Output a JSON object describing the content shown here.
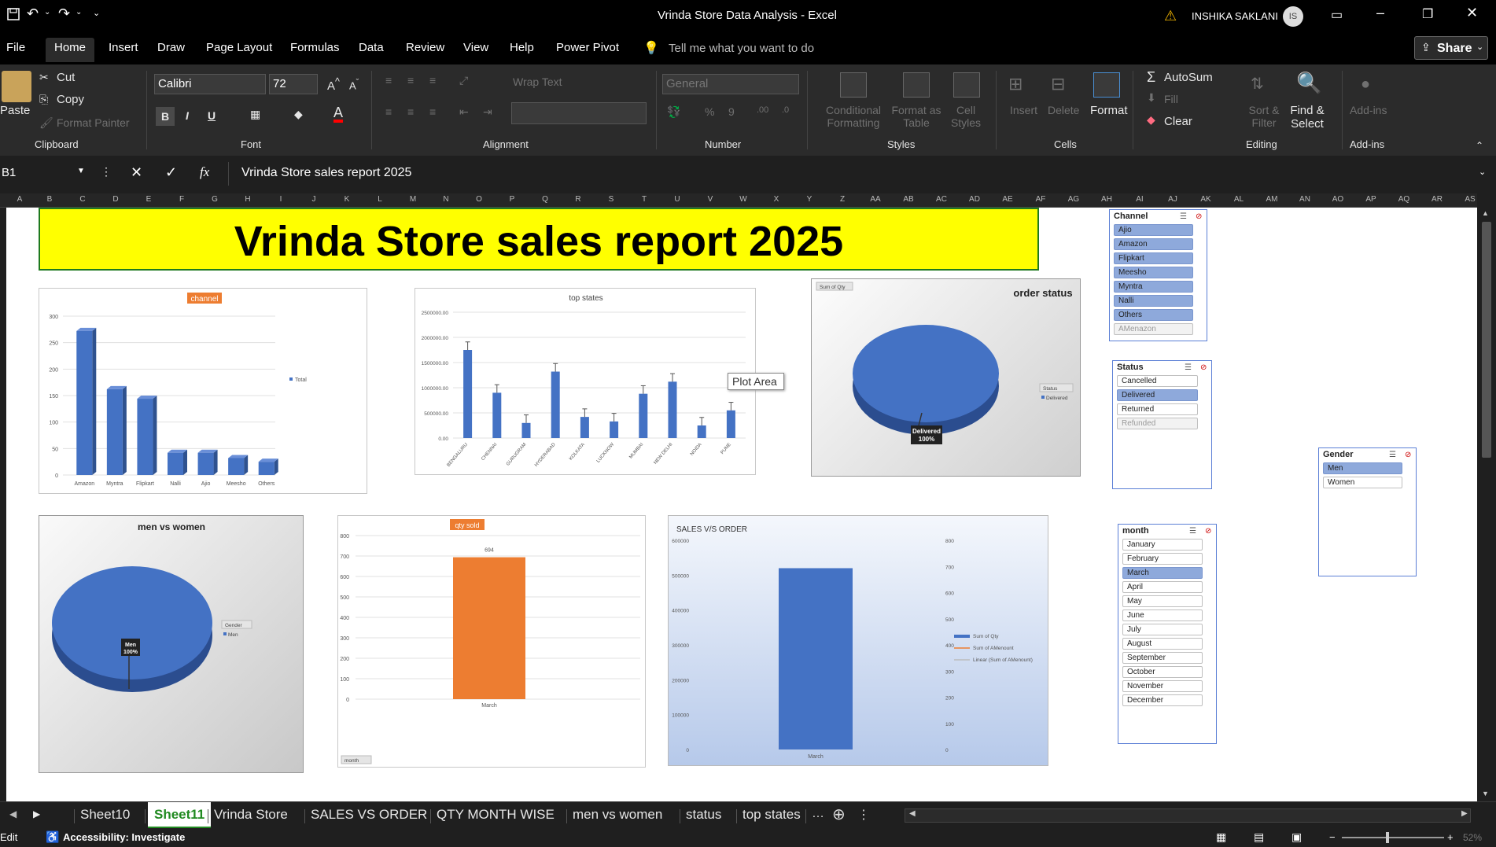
{
  "window": {
    "title": "Vrinda Store Data Analysis  -  Excel",
    "user": "INSHIKA SAKLANI",
    "user_initials": "IS"
  },
  "menu": [
    "File",
    "Home",
    "Insert",
    "Draw",
    "Page Layout",
    "Formulas",
    "Data",
    "Review",
    "View",
    "Help",
    "Power Pivot"
  ],
  "tell_me": "Tell me what you want to do",
  "share": "Share",
  "ribbon": {
    "clipboard": {
      "paste": "Paste",
      "cut": "Cut",
      "copy": "Copy",
      "format_painter": "Format Painter",
      "label": "Clipboard"
    },
    "font": {
      "name": "Calibri",
      "size": "72",
      "label": "Font"
    },
    "alignment": {
      "wrap_text": "Wrap Text",
      "label": "Alignment"
    },
    "number": {
      "format": "General",
      "label": "Number"
    },
    "styles": {
      "conditional": "Conditional Formatting",
      "format_table": "Format as Table",
      "cell_styles": "Cell Styles",
      "label": "Styles"
    },
    "cells": {
      "insert": "Insert",
      "delete": "Delete",
      "format": "Format",
      "label": "Cells"
    },
    "editing": {
      "autosum": "AutoSum",
      "fill": "Fill",
      "clear": "Clear",
      "sort": "Sort & Filter",
      "find": "Find & Select",
      "label": "Editing"
    },
    "addins": {
      "addins": "Add-ins",
      "label": "Add-ins"
    }
  },
  "formula_bar": {
    "name_box": "B1",
    "formula": "Vrinda Store sales report 2025"
  },
  "columns": [
    "A",
    "B",
    "C",
    "D",
    "E",
    "F",
    "G",
    "H",
    "I",
    "J",
    "K",
    "L",
    "M",
    "N",
    "O",
    "P",
    "Q",
    "R",
    "S",
    "T",
    "U",
    "V",
    "W",
    "X",
    "Y",
    "Z",
    "AA",
    "AB",
    "AC",
    "AD",
    "AE",
    "AF",
    "AG",
    "AH",
    "AI",
    "AJ",
    "AK",
    "AL",
    "AM",
    "AN",
    "AO",
    "AP",
    "AQ",
    "AR",
    "AS"
  ],
  "banner": {
    "text": "Vrinda Store sales report 2025",
    "bg": "#ffff00"
  },
  "tooltip": "Plot Area",
  "charts": {
    "channel": {
      "title": "channel",
      "legend": "Total",
      "title_bg": "#ed7d31",
      "bar_color": "#4472c4"
    },
    "top_states": {
      "title": "top states"
    },
    "order_status": {
      "title": "order status",
      "field": "Sum of Qty",
      "legend_field": "Status",
      "legend_item": "Delivered",
      "label": "Delivered",
      "pct": "100%"
    },
    "men_women": {
      "title": "men vs women",
      "legend_field": "Gender",
      "legend_item": "Men",
      "label": "Men",
      "pct": "100%"
    },
    "qty_sold": {
      "title": "qty sold",
      "field_btn": "month"
    },
    "sales_order": {
      "title": "SALES V/S ORDER",
      "legend": [
        "Sum of Qty",
        "Sum of AMenount",
        "Linear (Sum of AMenount)"
      ]
    }
  },
  "chart_data": [
    {
      "type": "bar",
      "title": "channel",
      "categories": [
        "Amazon",
        "Myntra",
        "Flipkart",
        "Nalli",
        "Ajio",
        "Meesho",
        "Others"
      ],
      "values": [
        272,
        162,
        144,
        42,
        42,
        32,
        25
      ],
      "ylim": [
        0,
        300
      ],
      "yticks": [
        0,
        50,
        100,
        150,
        200,
        250,
        300
      ],
      "series": [
        {
          "name": "Total",
          "values": [
            272,
            162,
            144,
            42,
            42,
            32,
            25
          ]
        }
      ]
    },
    {
      "type": "bar",
      "title": "top states",
      "categories": [
        "BENGALURU",
        "CHENNAI",
        "GURUGRAM",
        "HYDERABAD",
        "KOLKATA",
        "LUCKNOW",
        "MUMBAI",
        "NEW DELHI",
        "NOIDA",
        "PUNE"
      ],
      "values": [
        1750000,
        900000,
        300000,
        1320000,
        420000,
        330000,
        880000,
        1120000,
        250000,
        550000
      ],
      "errors": [
        160000,
        160000,
        160000,
        160000,
        160000,
        160000,
        160000,
        160000,
        160000,
        160000
      ],
      "ylim": [
        0,
        2500000
      ],
      "yticks": [
        "0.00",
        "500000.00",
        "1000000.00",
        "1500000.00",
        "2000000.00",
        "2500000.00"
      ]
    },
    {
      "type": "pie",
      "title": "order status",
      "labels": [
        "Delivered"
      ],
      "values": [
        100
      ]
    },
    {
      "type": "pie",
      "title": "men vs women",
      "labels": [
        "Men"
      ],
      "values": [
        100
      ]
    },
    {
      "type": "bar",
      "title": "qty sold",
      "categories": [
        "March"
      ],
      "values": [
        694
      ],
      "ylim": [
        0,
        800
      ],
      "yticks": [
        0,
        100,
        200,
        300,
        400,
        500,
        600,
        700,
        800
      ]
    },
    {
      "type": "bar",
      "title": "SALES V/S ORDER",
      "categories": [
        "March"
      ],
      "series": [
        {
          "name": "Sum of Qty",
          "values": [
            520000
          ]
        }
      ],
      "ylim": [
        0,
        600000
      ],
      "yticks": [
        0,
        100000,
        200000,
        300000,
        400000,
        500000,
        600000
      ],
      "y2ticks": [
        0,
        100,
        200,
        300,
        400,
        500,
        600,
        700,
        800
      ]
    }
  ],
  "slicers": {
    "channel": {
      "title": "Channel",
      "items": [
        {
          "l": "Ajio",
          "s": 1
        },
        {
          "l": "Amazon",
          "s": 1
        },
        {
          "l": "Flipkart",
          "s": 1
        },
        {
          "l": "Meesho",
          "s": 1
        },
        {
          "l": "Myntra",
          "s": 1
        },
        {
          "l": "Nalli",
          "s": 1
        },
        {
          "l": "Others",
          "s": 1
        },
        {
          "l": "AMenazon",
          "s": 2
        }
      ]
    },
    "status": {
      "title": "Status",
      "items": [
        {
          "l": "Cancelled",
          "s": 0
        },
        {
          "l": "Delivered",
          "s": 1
        },
        {
          "l": "Returned",
          "s": 0
        },
        {
          "l": "Refunded",
          "s": 2
        }
      ]
    },
    "gender": {
      "title": "Gender",
      "items": [
        {
          "l": "Men",
          "s": 1
        },
        {
          "l": "Women",
          "s": 0
        }
      ]
    },
    "month": {
      "title": "month",
      "items": [
        {
          "l": "January",
          "s": 0
        },
        {
          "l": "February",
          "s": 0
        },
        {
          "l": "March",
          "s": 1
        },
        {
          "l": "April",
          "s": 0
        },
        {
          "l": "May",
          "s": 0
        },
        {
          "l": "June",
          "s": 0
        },
        {
          "l": "July",
          "s": 0
        },
        {
          "l": "August",
          "s": 0
        },
        {
          "l": "September",
          "s": 0
        },
        {
          "l": "October",
          "s": 0
        },
        {
          "l": "November",
          "s": 0
        },
        {
          "l": "December",
          "s": 0
        }
      ]
    }
  },
  "sheet_tabs": [
    "Sheet10",
    "Sheet11",
    "Vrinda Store",
    "SALES VS ORDER",
    "QTY MONTH WISE",
    "men vs women",
    "status",
    "top states"
  ],
  "active_tab": "Sheet11",
  "status_bar": {
    "mode": "Edit",
    "accessibility": "Accessibility: Investigate",
    "zoom": "52%"
  }
}
